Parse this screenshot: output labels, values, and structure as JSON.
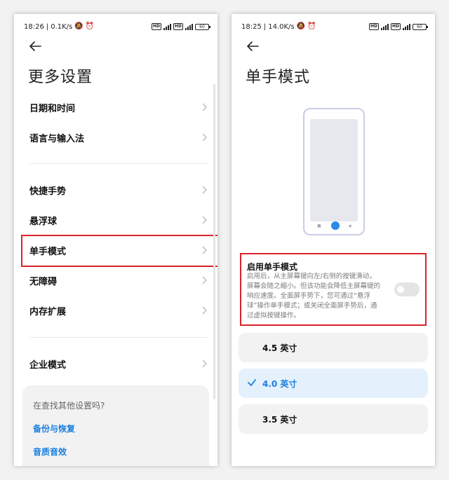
{
  "left": {
    "status": {
      "time": "18:26",
      "speed": "0.1K/s",
      "battery": "60"
    },
    "title": "更多设置",
    "items": [
      {
        "label": "日期和时间"
      },
      {
        "label": "语言与输入法"
      },
      {
        "label": "快捷手势"
      },
      {
        "label": "悬浮球"
      },
      {
        "label": "单手模式"
      },
      {
        "label": "无障碍"
      },
      {
        "label": "内存扩展"
      },
      {
        "label": "企业模式"
      }
    ],
    "suggest": {
      "title": "在查找其他设置吗?",
      "links": [
        "备份与恢复",
        "音质音效"
      ]
    }
  },
  "right": {
    "status": {
      "time": "18:25",
      "speed": "14.0K/s",
      "battery": "60"
    },
    "title": "单手模式",
    "enable_title": "启用单手模式",
    "enable_desc": "启用后，从主屏幕键向左/右侧的按键滑动，屏幕会随之缩小。但该功能会降低主屏幕键的响应速度。全面屏手势下，您可通过“悬浮球”操作单手模式；或关闭全面屏手势后，通过虚拟按键操作。",
    "toggle_on": false,
    "options": [
      {
        "label": "4.5 英寸",
        "selected": false
      },
      {
        "label": "4.0 英寸",
        "selected": true
      },
      {
        "label": "3.5 英寸",
        "selected": false
      }
    ]
  },
  "colors": {
    "accent": "#1a7fe0",
    "highlight_box": "#d9232b",
    "selected_bg": "#e4f1fd",
    "card_bg": "#f2f2f2"
  },
  "icons": [
    "back-arrow-icon",
    "chevron-right-icon",
    "checkmark-icon",
    "alarm-icon",
    "mute-icon",
    "signal-icon",
    "battery-icon"
  ]
}
